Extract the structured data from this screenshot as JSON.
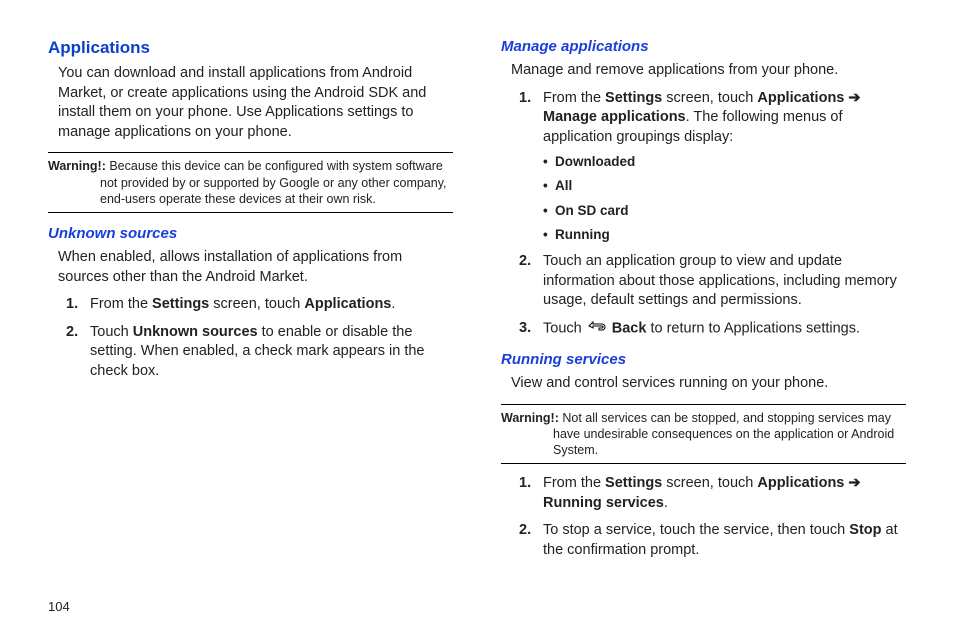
{
  "pageNumber": "104",
  "left": {
    "heading": "Applications",
    "intro": "You can download and install applications from Android Market, or create applications using the Android SDK and install them on your phone. Use Applications settings to manage applications on your phone.",
    "warningLabel": "Warning!:",
    "warningText": "Because this device can be configured with system software not provided by or supported by Google or any other company, end-users operate these devices at their own risk.",
    "sub1": "Unknown sources",
    "sub1Intro": "When enabled, allows installation of applications from sources other than the Android Market.",
    "step1_pre": "From the ",
    "step1_b1": "Settings",
    "step1_mid": " screen, touch ",
    "step1_b2": "Applications",
    "step1_post": ".",
    "step2_pre": "Touch ",
    "step2_b1": "Unknown sources",
    "step2_post": " to enable or disable the setting. When enabled, a check mark appears in the check box."
  },
  "right": {
    "sub1": "Manage applications",
    "sub1Intro": "Manage and remove applications from your phone.",
    "ma_step1_pre": "From the ",
    "ma_step1_b1": "Settings",
    "ma_step1_mid1": " screen, touch ",
    "ma_step1_b2": "Applications",
    "ma_step1_arrow": " ➔ ",
    "ma_step1_b3": "Manage applications",
    "ma_step1_post": ". The following menus of application groupings display:",
    "bullets": {
      "b1": "Downloaded",
      "b2": "All",
      "b3": "On SD card",
      "b4": "Running"
    },
    "ma_step2": "Touch an application group to view and update information about those applications, including memory usage, default settings and permissions.",
    "ma_step3_pre": "Touch ",
    "ma_step3_b1": "Back",
    "ma_step3_post": " to return to Applications settings.",
    "sub2": "Running services",
    "sub2Intro": "View and control services running on your phone.",
    "warningLabel": "Warning!:",
    "warningText": "Not all services can be stopped, and stopping services may have undesirable consequences on the application or Android System.",
    "rs_step1_pre": "From the ",
    "rs_step1_b1": "Settings",
    "rs_step1_mid1": " screen, touch ",
    "rs_step1_b2": "Applications",
    "rs_step1_arrow": " ➔ ",
    "rs_step1_b3": "Running services",
    "rs_step1_post": ".",
    "rs_step2_pre": "To stop a service, touch the service, then touch ",
    "rs_step2_b1": "Stop",
    "rs_step2_post": " at the confirmation prompt."
  }
}
